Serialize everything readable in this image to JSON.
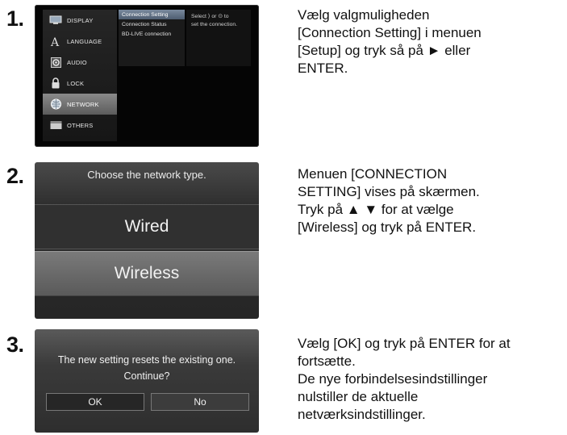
{
  "steps": [
    {
      "number": "1.",
      "description": [
        "Vælg valgmuligheden",
        "[Connection Setting] i menuen",
        "[Setup] og tryk så på ► eller",
        "ENTER."
      ],
      "screen": {
        "menu_items": [
          {
            "label": "DISPLAY",
            "icon": "display-icon"
          },
          {
            "label": "LANGUAGE",
            "icon": "language-icon"
          },
          {
            "label": "AUDIO",
            "icon": "audio-icon"
          },
          {
            "label": "LOCK",
            "icon": "lock-icon"
          },
          {
            "label": "NETWORK",
            "icon": "network-icon"
          },
          {
            "label": "OTHERS",
            "icon": "others-icon"
          }
        ],
        "selected_menu": "NETWORK",
        "sub_items": [
          "Connection Setting",
          "Connection Status",
          "BD-LIVE connection"
        ],
        "selected_sub": "Connection Setting",
        "help_text": [
          "Select ⟩ or ⊙ to",
          "set the connection."
        ]
      }
    },
    {
      "number": "2.",
      "description": [
        "Menuen [CONNECTION",
        "SETTING] vises på skærmen.",
        "Tryk på ▲ ▼ for at vælge",
        "[Wireless] og tryk på ENTER."
      ],
      "screen": {
        "title": "Choose the network type.",
        "options": [
          "Wired",
          "Wireless"
        ],
        "selected_option": "Wireless"
      }
    },
    {
      "number": "3.",
      "description": [
        "Vælg [OK] og tryk på ENTER for at",
        "fortsætte.",
        "De nye forbindelsesindstillinger",
        "nulstiller de aktuelle",
        "netværksindstillinger."
      ],
      "screen": {
        "message_line1": "The new setting resets the existing one.",
        "message_line2": "Continue?",
        "ok_label": "OK",
        "no_label": "No"
      }
    }
  ]
}
